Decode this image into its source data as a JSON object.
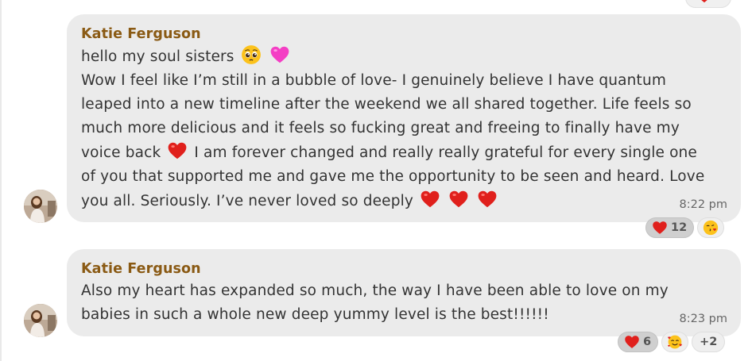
{
  "messages": [
    {
      "sender": "Katie Ferguson",
      "lines": {
        "l1": "hello my soul sisters",
        "l2": "Wow I feel like I’m still in a bubble of love- I genuinely believe I have quantum",
        "l3": "leaped into a new timeline after the weekend we all shared together. Life feels so",
        "l4": "much more delicious and it feels so fucking great and freeing to finally have my",
        "l5a": "voice back",
        "l5b": "I am forever changed and really really grateful for every single one",
        "l6": "of you that supported me and gave me the opportunity to be seen and heard. Love",
        "l7": "you all. Seriously. I’ve never loved so deeply"
      },
      "time": "8:22 pm",
      "reactions": [
        {
          "emoji": "red-heart",
          "count": "12",
          "active": true
        },
        {
          "emoji": "face-blowing-kiss",
          "count": ""
        }
      ]
    },
    {
      "sender": "Katie Ferguson",
      "lines": {
        "l1": "Also my heart has expanded so much, the way I have been able to love on my",
        "l2": "babies in such a whole new deep yummy level is the best!!!!!!"
      },
      "time": "8:23 pm",
      "reactions": [
        {
          "emoji": "red-heart",
          "count": "6",
          "active": true
        },
        {
          "emoji": "smiling-face-with-hearts",
          "count": ""
        },
        {
          "emoji": "",
          "count": "+2"
        }
      ]
    }
  ],
  "colors": {
    "bubble": "#ebebeb",
    "sender": "#8a5a14",
    "text": "#333333",
    "reaction_active": "#cfcfcf"
  }
}
